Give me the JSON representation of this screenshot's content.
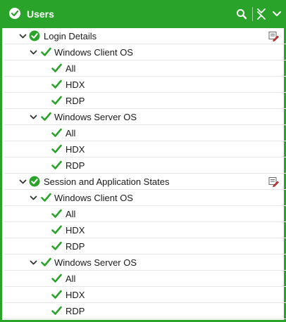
{
  "header": {
    "title": "Users",
    "accent_color": "#2aa32a",
    "icons": [
      "check-circle-icon",
      "search-icon",
      "collapse-all-icon",
      "chevron-down-icon"
    ]
  },
  "tree": {
    "groups": [
      {
        "label": "Login Details",
        "subgroups": [
          {
            "label": "Windows Client OS",
            "items": [
              "All",
              "HDX",
              "RDP"
            ]
          },
          {
            "label": "Windows Server OS",
            "items": [
              "All",
              "HDX",
              "RDP"
            ]
          }
        ]
      },
      {
        "label": "Session and Application States",
        "subgroups": [
          {
            "label": "Windows Client OS",
            "items": [
              "All",
              "HDX",
              "RDP"
            ]
          },
          {
            "label": "Windows Server OS",
            "items": [
              "All",
              "HDX",
              "RDP"
            ]
          }
        ]
      }
    ]
  }
}
